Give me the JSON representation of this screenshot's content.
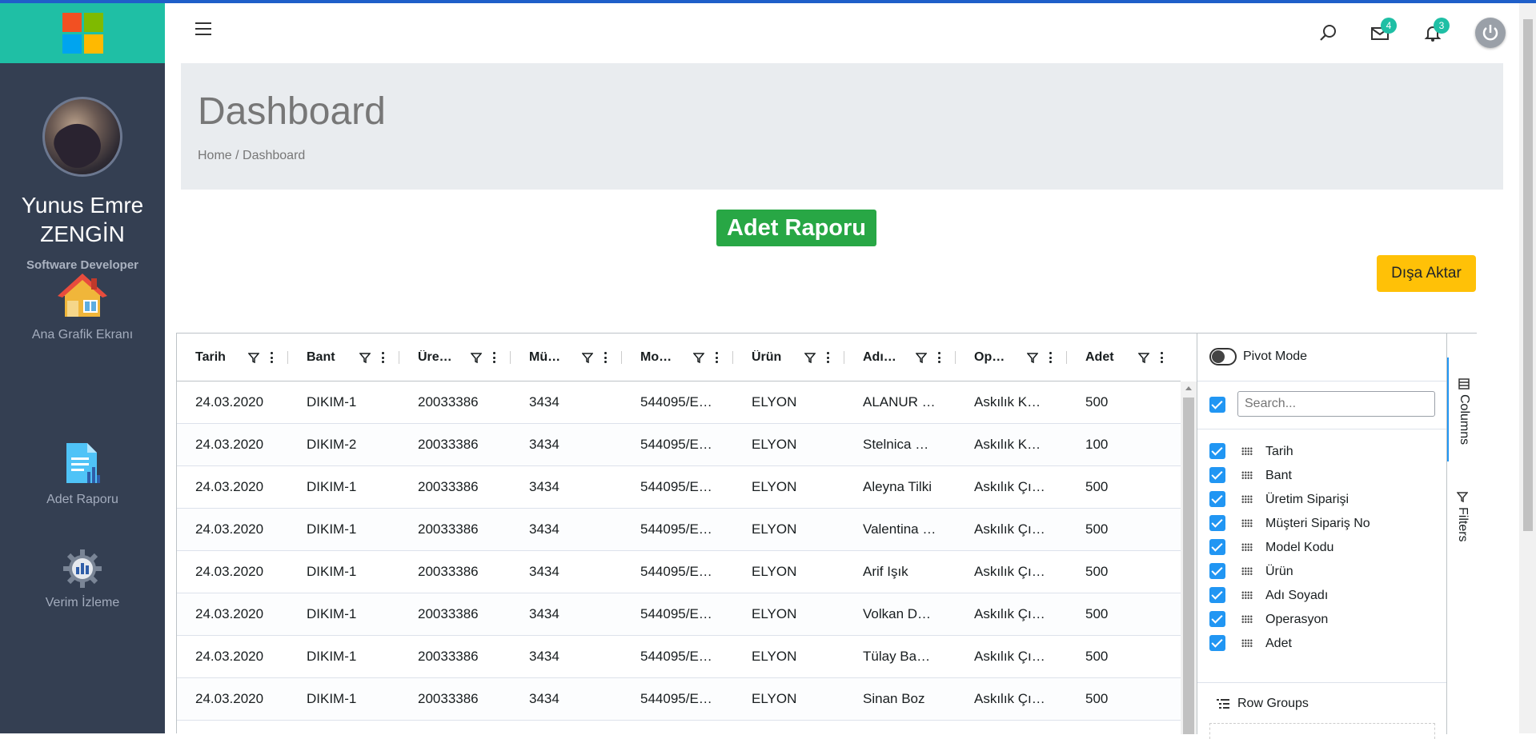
{
  "sidebar": {
    "logo_colors": [
      "#f25022",
      "#7fba00",
      "#00a4ef",
      "#ffb900"
    ],
    "user_name": "Yunus Emre ZENGİN",
    "user_role": "Software Developer",
    "nav": [
      {
        "label": "Ana Grafik Ekranı",
        "icon": "house-icon"
      },
      {
        "label": "Adet Raporu",
        "icon": "report-document-icon"
      },
      {
        "label": "Verim İzleme",
        "icon": "gear-chart-icon"
      }
    ]
  },
  "header": {
    "menu_icon": "hamburger-icon",
    "search_icon": "search-icon",
    "mail_icon": "mail-icon",
    "mail_badge": "4",
    "notification_icon": "bell-icon",
    "notification_badge": "3",
    "power_icon": "power-icon",
    "accent_color": "#1fbfa5"
  },
  "page": {
    "title": "Dashboard",
    "breadcrumb": "Home / Dashboard",
    "report_title": "Adet Raporu",
    "export_label": "Dışa Aktar"
  },
  "grid": {
    "columns": [
      "Tarih",
      "Bant",
      "Üre…",
      "Mü…",
      "Mo…",
      "Ürün",
      "Adı…",
      "Op…",
      "Adet"
    ],
    "rows": [
      [
        "24.03.2020",
        "DIKIM-1",
        "20033386",
        "3434",
        "544095/E…",
        "ELYON",
        "ALANUR …",
        "Askılık K…",
        "500"
      ],
      [
        "24.03.2020",
        "DIKIM-2",
        "20033386",
        "3434",
        "544095/E…",
        "ELYON",
        "Stelnica …",
        "Askılık K…",
        "100"
      ],
      [
        "24.03.2020",
        "DIKIM-1",
        "20033386",
        "3434",
        "544095/E…",
        "ELYON",
        "Aleyna Tilki",
        "Askılık Çı…",
        "500"
      ],
      [
        "24.03.2020",
        "DIKIM-1",
        "20033386",
        "3434",
        "544095/E…",
        "ELYON",
        "Valentina …",
        "Askılık Çı…",
        "500"
      ],
      [
        "24.03.2020",
        "DIKIM-1",
        "20033386",
        "3434",
        "544095/E…",
        "ELYON",
        "Arif Işık",
        "Askılık Çı…",
        "500"
      ],
      [
        "24.03.2020",
        "DIKIM-1",
        "20033386",
        "3434",
        "544095/E…",
        "ELYON",
        "Volkan D…",
        "Askılık Çı…",
        "500"
      ],
      [
        "24.03.2020",
        "DIKIM-1",
        "20033386",
        "3434",
        "544095/E…",
        "ELYON",
        "Tülay Ba…",
        "Askılık Çı…",
        "500"
      ],
      [
        "24.03.2020",
        "DIKIM-1",
        "20033386",
        "3434",
        "544095/E…",
        "ELYON",
        "Sinan Boz",
        "Askılık Çı…",
        "500"
      ]
    ]
  },
  "tool_panel": {
    "pivot_label": "Pivot Mode",
    "pivot_enabled": false,
    "search_placeholder": "Search...",
    "columns": [
      "Tarih",
      "Bant",
      "Üretim Siparişi",
      "Müşteri Sipariş No",
      "Model Kodu",
      "Ürün",
      "Adı Soyadı",
      "Operasyon",
      "Adet"
    ],
    "row_groups_label": "Row Groups",
    "side_tabs": [
      "Columns",
      "Filters"
    ]
  }
}
